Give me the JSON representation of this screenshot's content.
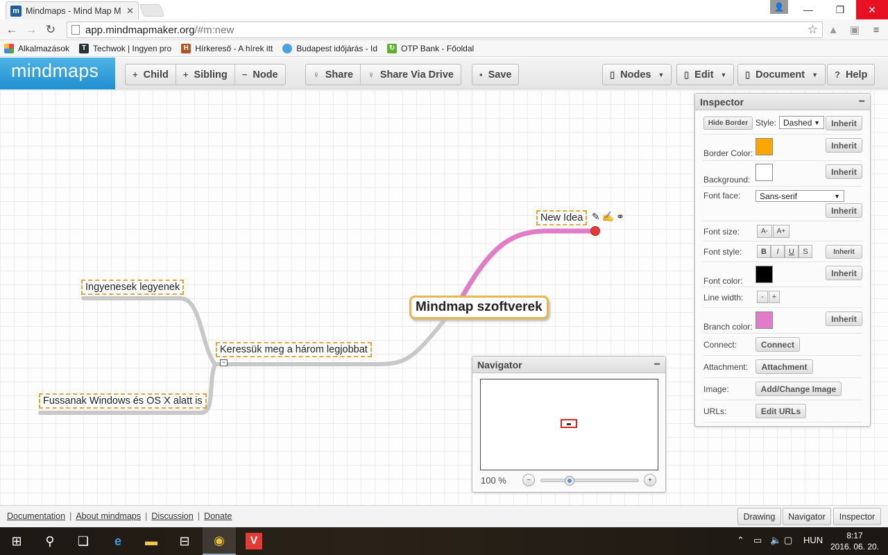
{
  "browser": {
    "tab_title": "Mindmaps - Mind Map M",
    "tab_favicon": "m",
    "url_host": "app.mindmapmaker.org",
    "url_path": "/#m:new",
    "bookmarks": [
      {
        "label": "Alkalmazások",
        "icon": "apps-grid-icon"
      },
      {
        "label": "Techwok | Ingyen pro",
        "icon": "techwok-icon"
      },
      {
        "label": "Hírkereső - A hírek itt",
        "icon": "hirkereso-icon"
      },
      {
        "label": "Budapest időjárás - Id",
        "icon": "weather-icon"
      },
      {
        "label": "OTP Bank - Főoldal",
        "icon": "otp-icon"
      }
    ]
  },
  "app": {
    "logo": "mindmaps",
    "toolbar": {
      "child": "Child",
      "sibling": "Sibling",
      "node": "Node",
      "share": "Share",
      "share_drive": "Share Via Drive",
      "save": "Save",
      "nodes": "Nodes",
      "edit": "Edit",
      "document": "Document",
      "help": "Help"
    }
  },
  "mindmap": {
    "root": "Mindmap szoftverek",
    "new_idea": "New Idea",
    "branch_left": "Keressük meg a három legjobbat",
    "leaf_top": "Ingyenesek legyenek",
    "leaf_bottom": "Fussanak Windows és OS X alatt is",
    "branch_color": "#e07cc8",
    "grey_branch_color": "#c8c8c8"
  },
  "navigator": {
    "title": "Navigator",
    "zoom": "100 %",
    "zoom_level": 0.27
  },
  "inspector": {
    "title": "Inspector",
    "hide_border": "Hide Border",
    "style_label": "Style:",
    "style_value": "Dashed",
    "inherit": "Inherit",
    "border_color_label": "Border Color:",
    "border_color": "#ffa500",
    "background_label": "Background:",
    "background_color": "#ffffff",
    "font_face_label": "Font face:",
    "font_face_value": "Sans-serif",
    "font_size_label": "Font size:",
    "font_size_down": "A-",
    "font_size_up": "A+",
    "font_style_label": "Font style:",
    "bold": "B",
    "italic": "I",
    "underline": "U",
    "strike": "S",
    "font_color_label": "Font color:",
    "font_color": "#000000",
    "line_width_label": "Line width:",
    "line_minus": "-",
    "line_plus": "+",
    "branch_color_label": "Branch color:",
    "branch_color": "#e07cc8",
    "connect_label": "Connect:",
    "connect_btn": "Connect",
    "attachment_label": "Attachment:",
    "attachment_btn": "Attachment",
    "image_label": "Image:",
    "image_btn": "Add/Change Image",
    "urls_label": "URLs:",
    "urls_btn": "Edit URLs"
  },
  "footer": {
    "links": [
      "Documentation",
      "About mindmaps",
      "Discussion",
      "Donate"
    ],
    "drawing": "Drawing",
    "navigator": "Navigator",
    "inspector": "Inspector"
  },
  "taskbar": {
    "lang": "HUN",
    "time": "8:17",
    "date": "2016. 06. 20."
  }
}
